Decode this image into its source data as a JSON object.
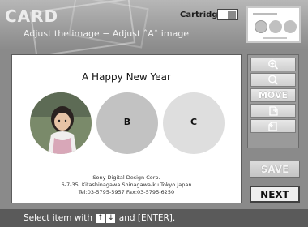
{
  "header": {
    "title": "CARD",
    "subtitle": "Adjust the image − Adjust ˆAˆ image",
    "cartridge_label": "Cartridge"
  },
  "card": {
    "greeting": "A Happy New Year",
    "slots": [
      {
        "label": "",
        "kind": "photo"
      },
      {
        "label": "B",
        "kind": "empty"
      },
      {
        "label": "C",
        "kind": "empty"
      }
    ],
    "footer": [
      "Sony Digital Design Corp.",
      "6-7-35, Kitashinagawa Shinagawa-ku Tokyo Japan",
      "Tel:03-5795-5957  Fax:03-5795-6250"
    ]
  },
  "side_panel": {
    "buttons": [
      {
        "label": "",
        "icon": "zoom-in-icon"
      },
      {
        "label": "",
        "icon": "zoom-out-icon"
      },
      {
        "label": "MOVE",
        "icon": ""
      },
      {
        "label": "",
        "icon": "rotate-right-icon"
      },
      {
        "label": "",
        "icon": "rotate-left-icon"
      }
    ]
  },
  "actions": {
    "save_label": "SAVE",
    "next_label": "NEXT"
  },
  "status": {
    "prefix": "Select item with",
    "key_up": "↑",
    "key_down": "↓",
    "suffix": "and [ENTER]."
  },
  "colors": {
    "header_bg": "#9d9d9d",
    "status_bg": "#5a5a5a",
    "circle_b": "#c2c2c2",
    "circle_c": "#dedede"
  }
}
